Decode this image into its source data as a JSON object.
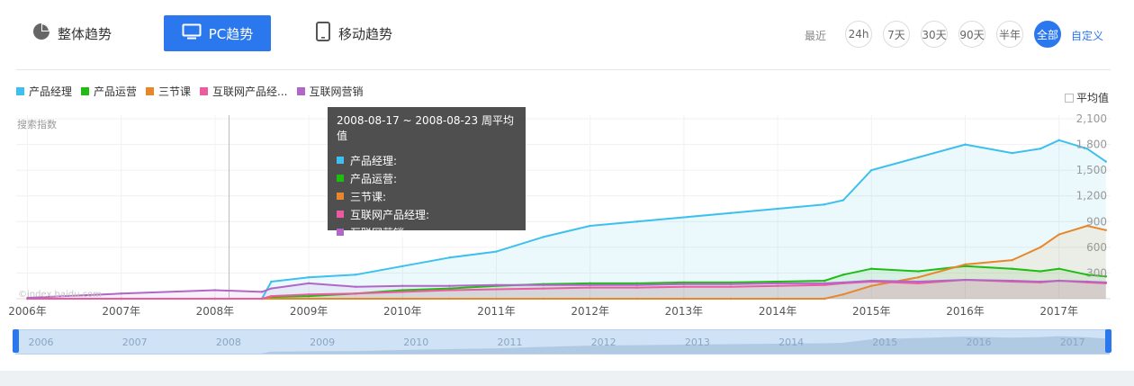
{
  "tabs": [
    {
      "label": "整体趋势",
      "icon": "pie-chart-icon",
      "active": false
    },
    {
      "label": "PC趋势",
      "icon": "monitor-icon",
      "active": true
    },
    {
      "label": "移动趋势",
      "icon": "tablet-icon",
      "active": false
    }
  ],
  "range": {
    "label": "最近",
    "buttons": [
      "24h",
      "7天",
      "30天",
      "90天",
      "半年",
      "全部"
    ],
    "active": "全部",
    "custom": "自定义"
  },
  "legend": [
    "产品经理",
    "产品运营",
    "三节课",
    "互联网产品经...",
    "互联网营销"
  ],
  "avg_toggle": "平均值",
  "watermark": "©index.baidu.com",
  "tooltip": {
    "title": "2008-08-17 ~ 2008-08-23 周平均值",
    "rows": [
      "产品经理:",
      "产品运营:",
      "三节课:",
      "互联网产品经理:",
      "互联网营销:"
    ]
  },
  "navigator": {
    "labels": [
      "2006",
      "2007",
      "2008",
      "2009",
      "2010",
      "2011",
      "2012",
      "2013",
      "2014",
      "2015",
      "2016",
      "2017"
    ]
  },
  "chart_data": {
    "type": "line",
    "ylabel": "搜索指数",
    "yticks": [
      "2,100",
      "1,800",
      "1,500",
      "1,200",
      "900",
      "600",
      "300"
    ],
    "ylim": [
      0,
      2100
    ],
    "xticks": [
      "2006年",
      "2007年",
      "2008年",
      "2009年",
      "2010年",
      "2011年",
      "2012年",
      "2013年",
      "2014年",
      "2015年",
      "2016年",
      "2017年"
    ],
    "x": [
      2006.0,
      2007.0,
      2008.0,
      2008.5,
      2008.6,
      2009.0,
      2009.5,
      2010.0,
      2010.5,
      2011.0,
      2011.5,
      2012.0,
      2012.5,
      2013.0,
      2013.5,
      2014.0,
      2014.5,
      2014.7,
      2015.0,
      2015.5,
      2016.0,
      2016.5,
      2016.8,
      2017.0,
      2017.3,
      2017.5
    ],
    "grid": true,
    "legend_position": "top-left",
    "series": [
      {
        "name": "产品经理",
        "color": "#3ec0ee",
        "values": [
          0,
          0,
          0,
          0,
          200,
          250,
          280,
          380,
          480,
          550,
          720,
          850,
          900,
          950,
          1000,
          1050,
          1100,
          1150,
          1500,
          1650,
          1800,
          1700,
          1750,
          1850,
          1750,
          1600
        ]
      },
      {
        "name": "产品运营",
        "color": "#1fbd12",
        "values": [
          0,
          0,
          0,
          0,
          20,
          30,
          60,
          100,
          120,
          150,
          170,
          180,
          180,
          190,
          190,
          200,
          210,
          280,
          350,
          320,
          380,
          350,
          320,
          350,
          280,
          260
        ]
      },
      {
        "name": "三节课",
        "color": "#e8862a",
        "values": [
          0,
          0,
          0,
          0,
          0,
          0,
          0,
          0,
          0,
          0,
          0,
          0,
          0,
          0,
          0,
          0,
          0,
          50,
          150,
          250,
          400,
          450,
          600,
          750,
          850,
          800
        ]
      },
      {
        "name": "互联网产品经理",
        "color": "#ee5aa0",
        "values": [
          0,
          0,
          0,
          0,
          30,
          50,
          60,
          80,
          100,
          110,
          120,
          130,
          130,
          140,
          140,
          150,
          160,
          180,
          200,
          180,
          220,
          200,
          190,
          210,
          190,
          180
        ]
      },
      {
        "name": "互联网营销",
        "color": "#b067c8",
        "values": [
          10,
          60,
          100,
          80,
          120,
          180,
          140,
          150,
          150,
          160,
          160,
          160,
          160,
          170,
          170,
          180,
          180,
          190,
          210,
          200,
          220,
          210,
          200,
          210,
          200,
          190
        ]
      }
    ]
  }
}
